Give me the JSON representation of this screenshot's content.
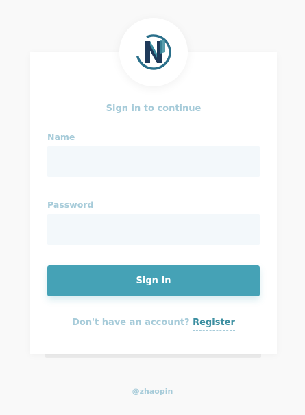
{
  "login": {
    "subtitle": "Sign in to continue",
    "name_label": "Name",
    "name_value": "",
    "name_placeholder": "",
    "password_label": "Password",
    "password_value": "",
    "password_placeholder": "",
    "submit_label": "Sign In",
    "register_prompt": "Don't have an account?",
    "register_link": "Register"
  },
  "logo": {
    "icon": "n-logo-icon"
  },
  "footer": {
    "credit": "@zhaopin"
  },
  "colors": {
    "background": "#f9f9f9",
    "card": "#ffffff",
    "accent": "#45a2b6",
    "label": "#a6cbd9",
    "input_bg": "#f3f8fb",
    "logo_dark": "#1f3a5a",
    "logo_light": "#3b8ea0"
  }
}
